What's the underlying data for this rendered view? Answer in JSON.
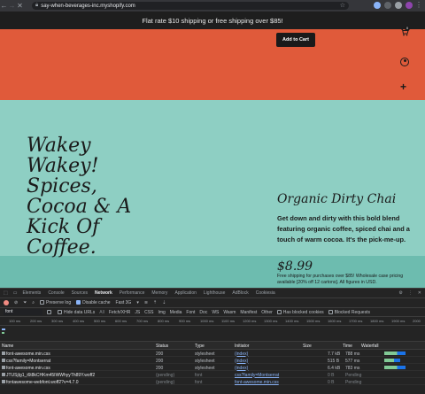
{
  "browser": {
    "url": "say-when-beverages-inc.myshopify.com"
  },
  "site": {
    "announcement": "Flat rate $10 shipping or free shipping over $85!",
    "add_to_cart": "Add to Cart",
    "cart_count": "0",
    "headline": "Wakey Wakey! Spices, Cocoa & A Kick Of Coffee.",
    "product_title": "Organic Dirty Chai",
    "product_description": "Get down and dirty with this bold blend featuring organic coffee, spiced chai and a touch of warm cocoa. It's the pick-me-up.",
    "price": "$8.99",
    "shipping_note": "Free shipping for purchases over $85! Wholesale case pricing available [20% off 12 cartons]. All figures in USD.",
    "colors": {
      "top": "#e05a3a",
      "main": "#8ecfc3"
    }
  },
  "devtools": {
    "tabs": [
      "Elements",
      "Console",
      "Sources",
      "Network",
      "Performance",
      "Memory",
      "Application",
      "Lighthouse",
      "AdBlock",
      "Cookiesia"
    ],
    "active_tab": "Network",
    "toolbar": {
      "preserve_log": "Preserve log",
      "disable_cache": "Disable cache",
      "throttle": "Fast 3G"
    },
    "filter": {
      "value": "font",
      "hide_data_urls": "Hide data URLs",
      "types": [
        "Fetch/XHR",
        "JS",
        "CSS",
        "Img",
        "Media",
        "Font",
        "Doc",
        "WS",
        "Wasm",
        "Manifest",
        "Other"
      ],
      "has_blocked_cookies": "Has blocked cookies",
      "blocked_requests": "Blocked Requests"
    },
    "timeline_ticks": [
      "100 ms",
      "200 ms",
      "300 ms",
      "400 ms",
      "500 ms",
      "600 ms",
      "700 ms",
      "800 ms",
      "900 ms",
      "1000 ms",
      "1100 ms",
      "1200 ms",
      "1300 ms",
      "1400 ms",
      "1500 ms",
      "1600 ms",
      "1700 ms",
      "1800 ms",
      "1900 ms",
      "2000"
    ],
    "columns": [
      "Name",
      "Status",
      "Type",
      "Initiator",
      "Size",
      "Time",
      "Waterfall"
    ],
    "rows": [
      {
        "name": "font-awesome.min.css",
        "status": "200",
        "type": "stylesheet",
        "initiator": "(index)",
        "size": "7.7 kB",
        "time": "788 ms"
      },
      {
        "name": "css?family=Montserrat",
        "status": "200",
        "type": "stylesheet",
        "initiator": "(index)",
        "size": "515 B",
        "time": "577 ms"
      },
      {
        "name": "font-awesome.min.css",
        "status": "200",
        "type": "stylesheet",
        "initiator": "(index)",
        "size": "6.4 kB",
        "time": "783 ms"
      },
      {
        "name": "JTUSjIg1_i6t8kCHKm45IWWhyyTh89Y.woff2",
        "status": "(pending)",
        "type": "font",
        "initiator": "css?family=Montserrat",
        "size": "0 B",
        "time": "Pending"
      },
      {
        "name": "fontawesome-webfont.woff2?v=4.7.0",
        "status": "(pending)",
        "type": "font",
        "initiator": "font-awesome.min.css",
        "size": "0 B",
        "time": "Pending"
      }
    ]
  }
}
